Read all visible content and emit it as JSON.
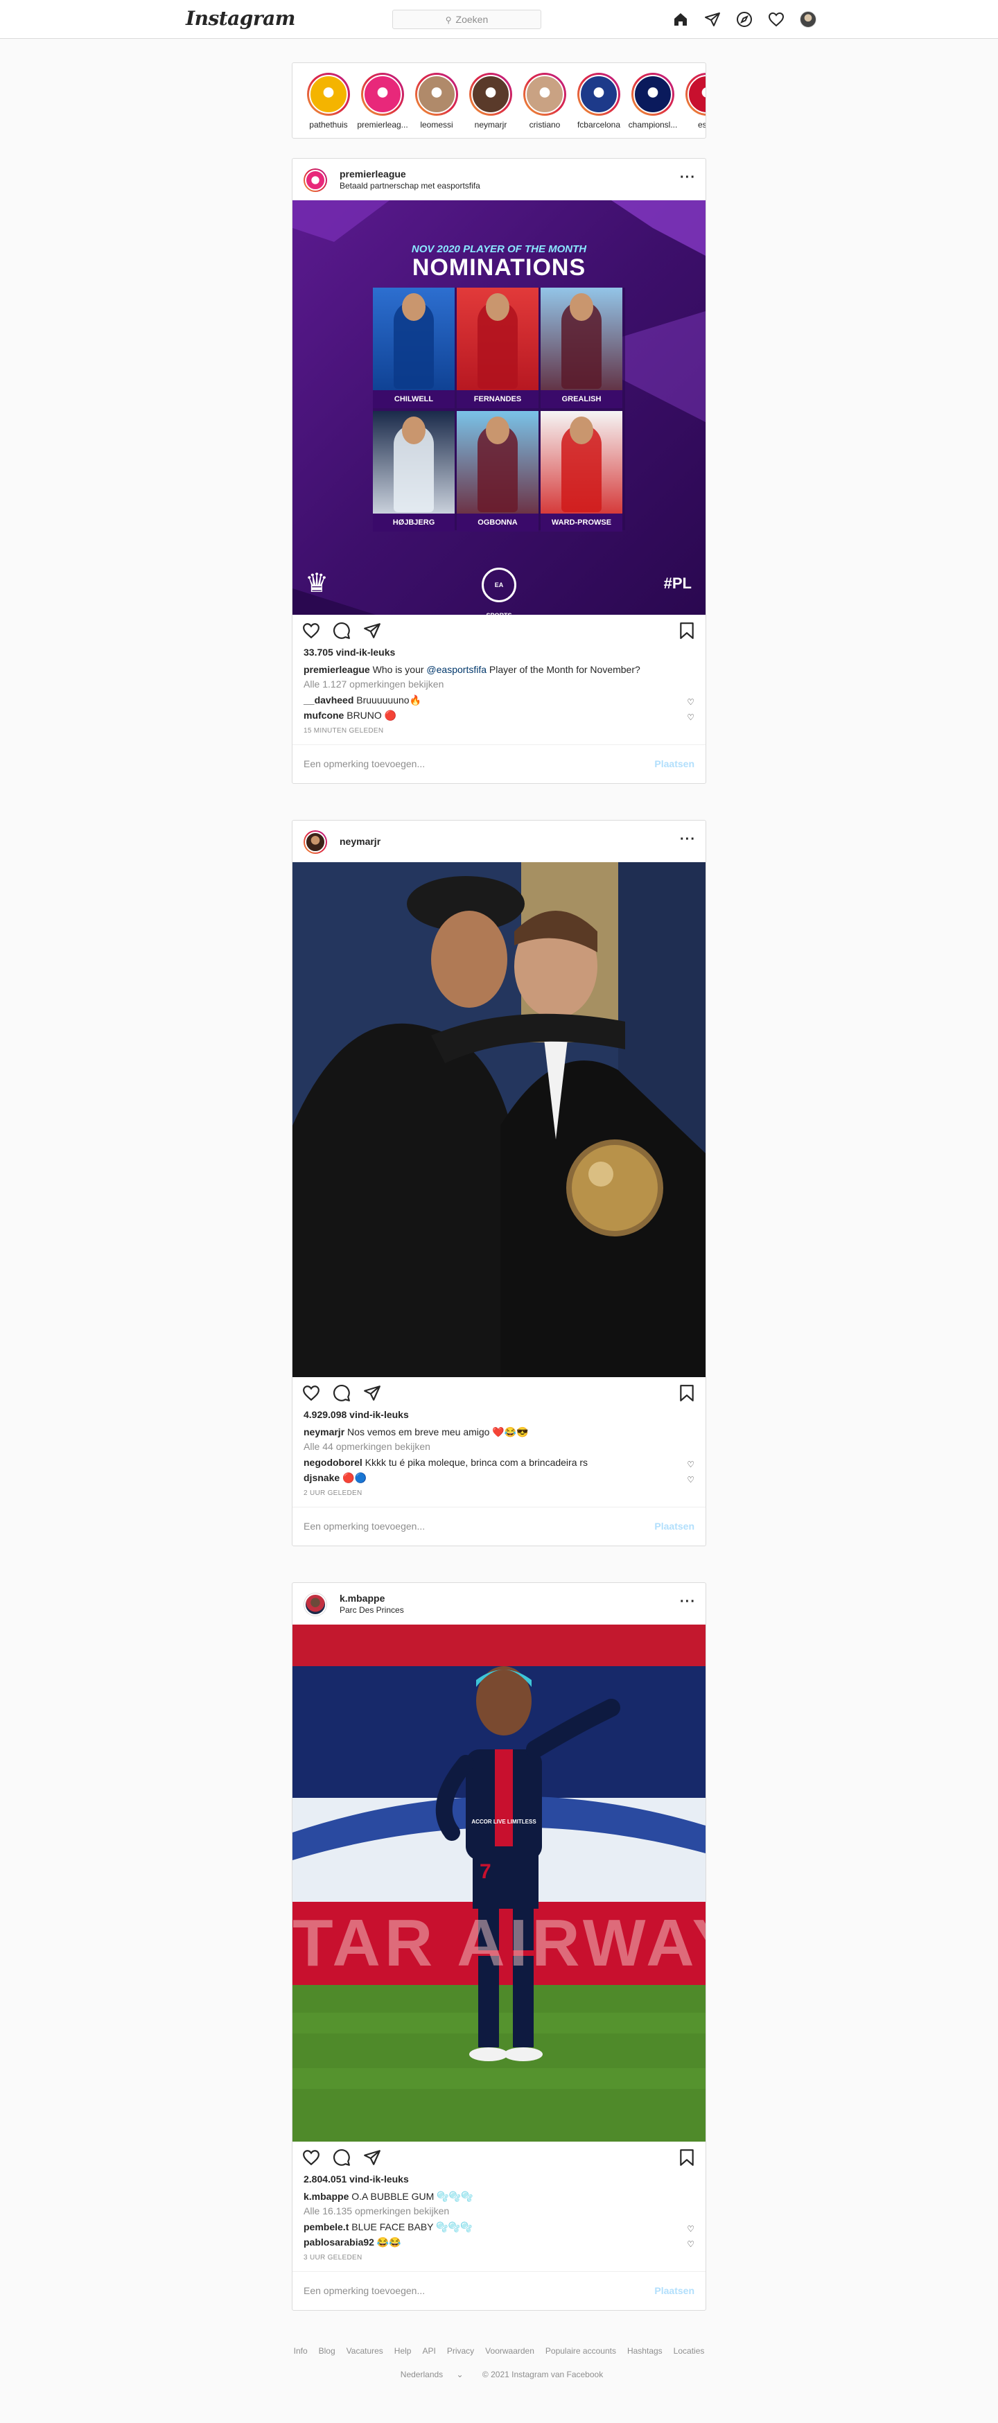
{
  "nav": {
    "logo": "Instagram",
    "search_placeholder": "Zoeken",
    "icons": [
      "home-icon",
      "direct-icon",
      "explore-icon",
      "activity-icon",
      "profile-avatar"
    ]
  },
  "stories": [
    {
      "name": "pathethuis",
      "color": "#f4b400"
    },
    {
      "name": "premierleag...",
      "color": "#e8287a"
    },
    {
      "name": "leomessi",
      "color": "#b08a6a"
    },
    {
      "name": "neymarjr",
      "color": "#5a3a2a"
    },
    {
      "name": "cristiano",
      "color": "#c9a283"
    },
    {
      "name": "fcbarcelona",
      "color": "#1d3a8a"
    },
    {
      "name": "championsl...",
      "color": "#0a1a5c"
    },
    {
      "name": "espn",
      "color": "#c8102e"
    }
  ],
  "posts": [
    {
      "user": "premierleague",
      "subtitle": "Betaald partnerschap met easportsfifa",
      "image": {
        "header_small": "NOV 2020 PLAYER OF THE MONTH",
        "header_big": "NOMINATIONS",
        "players": [
          "CHILWELL",
          "FERNANDES",
          "GREALISH",
          "HØJBJERG",
          "OGBONNA",
          "WARD-PROWSE"
        ],
        "badge": "EA SPORTS",
        "hashtag": "#PL"
      },
      "likes": "33.705 vind-ik-leuks",
      "caption_user": "premierleague",
      "caption_pre": "Who is your",
      "caption_mention": "@easportsfifa",
      "caption_post": "Player of the Month for November?",
      "view_all": "Alle 1.127 opmerkingen bekijken",
      "comments": [
        {
          "user": "__davheed",
          "text": "Bruuuuuuno🔥"
        },
        {
          "user": "mufcone",
          "text": "BRUNO 🔴"
        }
      ],
      "time": "15 MINUTEN GELEDEN",
      "add_comment": "Een opmerking toevoegen...",
      "post_label": "Plaatsen"
    },
    {
      "user": "neymarjr",
      "subtitle": "",
      "likes": "4.929.098 vind-ik-leuks",
      "caption_user": "neymarjr",
      "caption_text": "Nos vemos em breve meu amigo ❤️😂😎",
      "view_all": "Alle 44 opmerkingen bekijken",
      "comments": [
        {
          "user": "negodoborel",
          "text": "Kkkk tu é pika moleque, brinca com a brincadeira rs"
        },
        {
          "user": "djsnake",
          "text": "🔴🔵"
        }
      ],
      "time": "2 UUR GELEDEN",
      "add_comment": "Een opmerking toevoegen...",
      "post_label": "Plaatsen"
    },
    {
      "user": "k.mbappe",
      "subtitle": "Parc Des Princes",
      "image": {
        "sponsor": "ACCOR LIVE LIMITLESS",
        "number": "7",
        "banner": "TAR AIRWAYS"
      },
      "likes": "2.804.051 vind-ik-leuks",
      "caption_user": "k.mbappe",
      "caption_text": "O.A BUBBLE GUM 🫧🫧🫧",
      "view_all": "Alle 16.135 opmerkingen bekijken",
      "comments": [
        {
          "user": "pembele.t",
          "text": "BLUE FACE BABY 🫧🫧🫧"
        },
        {
          "user": "pablosarabia92",
          "text": "😂😂"
        }
      ],
      "time": "3 UUR GELEDEN",
      "add_comment": "Een opmerking toevoegen...",
      "post_label": "Plaatsen"
    }
  ],
  "footer": {
    "links": [
      "Info",
      "Blog",
      "Vacatures",
      "Help",
      "API",
      "Privacy",
      "Voorwaarden",
      "Populaire accounts",
      "Hashtags",
      "Locaties"
    ],
    "language": "Nederlands",
    "copyright": "© 2021 Instagram van Facebook"
  }
}
